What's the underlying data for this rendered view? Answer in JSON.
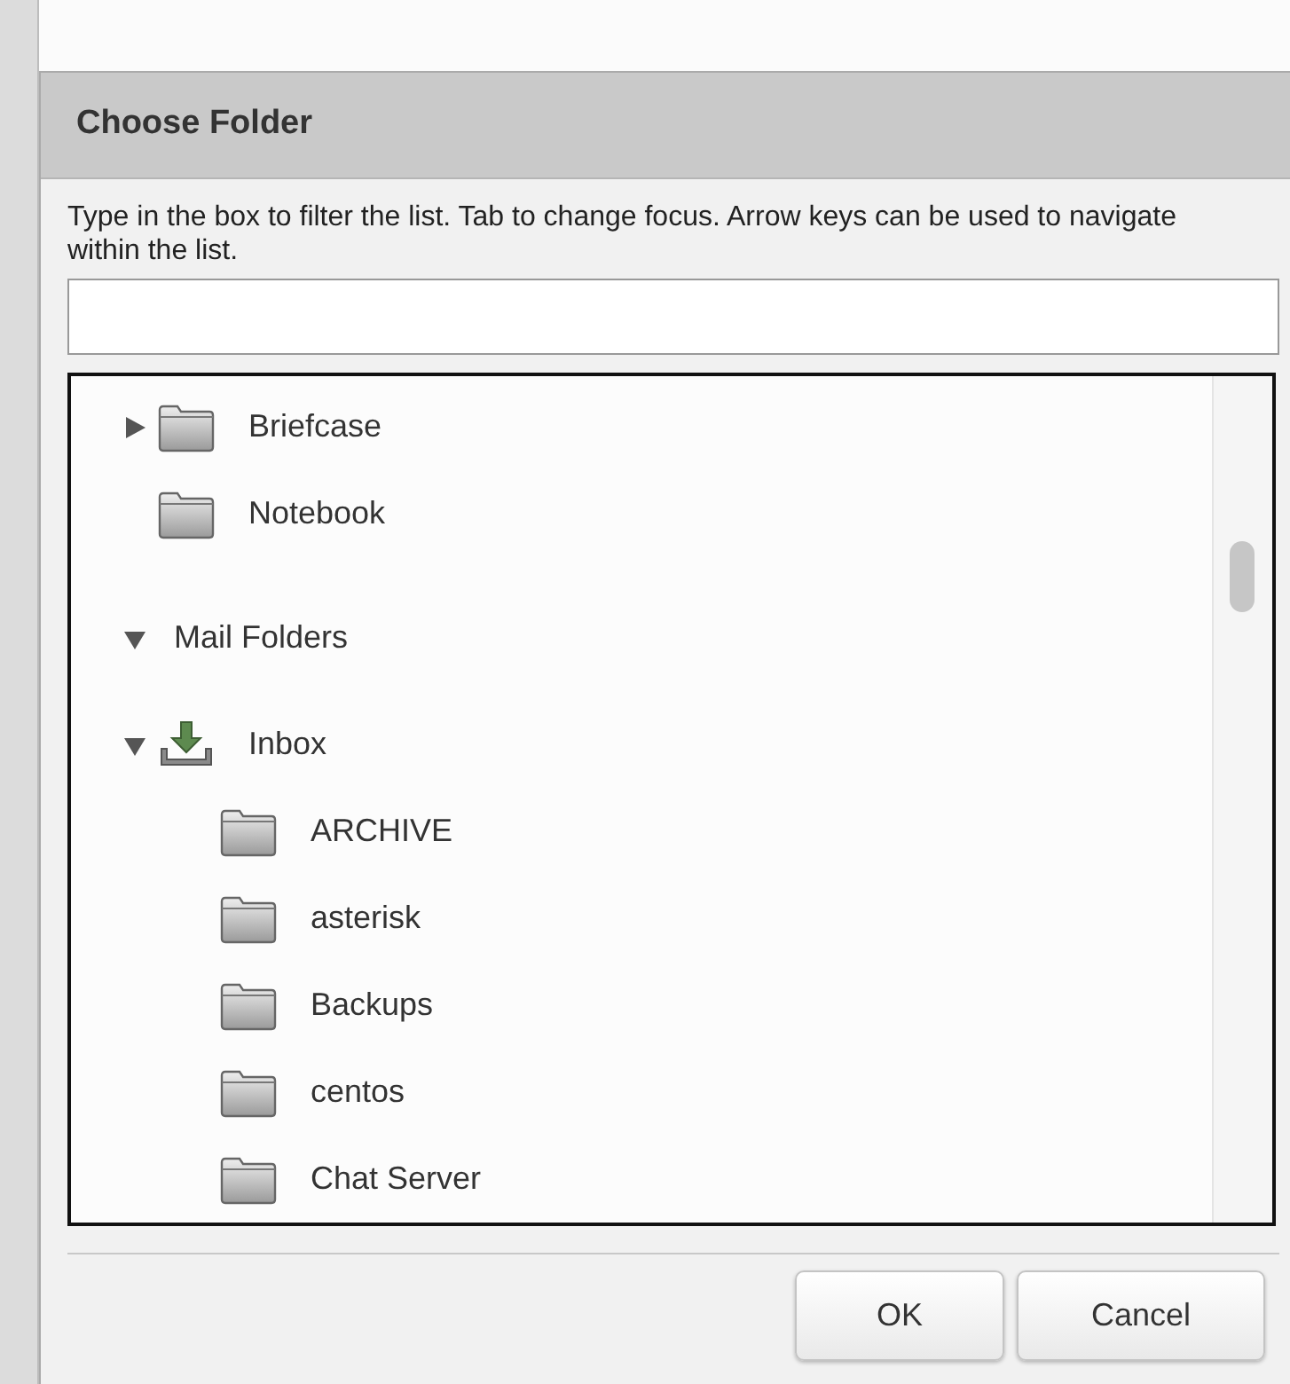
{
  "dialog": {
    "title": "Choose Folder",
    "instructions": "Type in the box to filter the list. Tab to change focus. Arrow keys can be used to navigate within the list.",
    "tree": [
      {
        "label": "Briefcase",
        "kind": "folder",
        "expanded": false
      },
      {
        "label": "Notebook",
        "kind": "folder"
      },
      {
        "label": "Mail Folders",
        "kind": "section",
        "expanded": true,
        "children": [
          {
            "label": "Inbox",
            "kind": "inbox",
            "expanded": true,
            "children": [
              {
                "label": "ARCHIVE",
                "kind": "folder"
              },
              {
                "label": "asterisk",
                "kind": "folder"
              },
              {
                "label": "Backups",
                "kind": "folder"
              },
              {
                "label": "centos",
                "kind": "folder"
              },
              {
                "label": "Chat Server",
                "kind": "folder"
              }
            ]
          }
        ]
      }
    ],
    "buttons": [
      "OK",
      "Cancel"
    ]
  }
}
